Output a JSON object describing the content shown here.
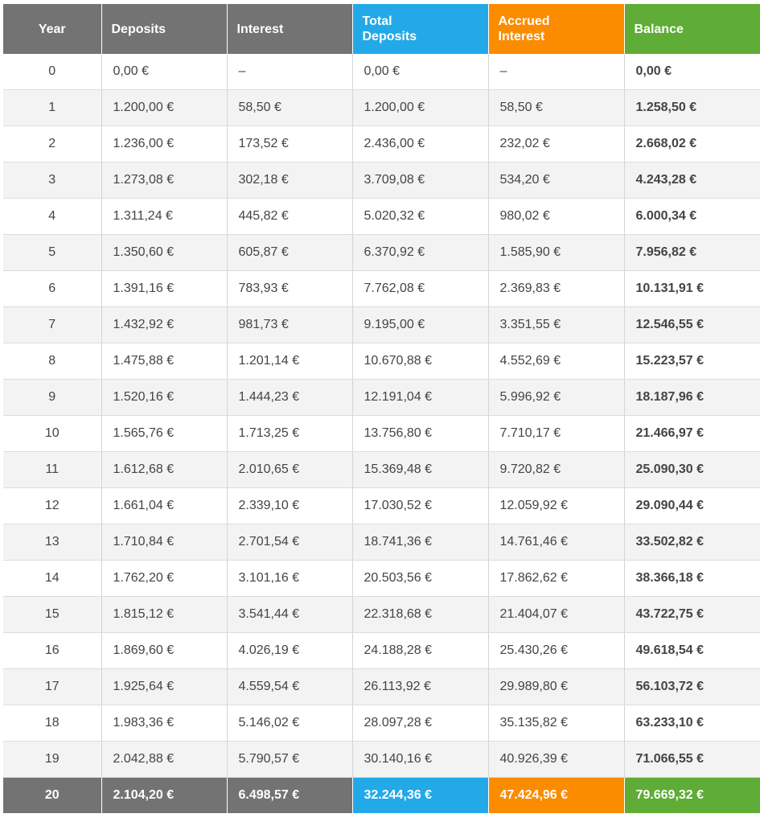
{
  "table": {
    "headers": {
      "year": "Year",
      "deposits": "Deposits",
      "interest": "Interest",
      "total_deposits_line1": "Total",
      "total_deposits_line2": "Deposits",
      "accrued_interest_line1": "Accrued",
      "accrued_interest_line2": "Interest",
      "balance": "Balance"
    },
    "rows": [
      {
        "year": "0",
        "deposits": "0,00 €",
        "interest": "–",
        "total_deposits": "0,00 €",
        "accrued_interest": "–",
        "balance": "0,00 €"
      },
      {
        "year": "1",
        "deposits": "1.200,00 €",
        "interest": "58,50 €",
        "total_deposits": "1.200,00 €",
        "accrued_interest": "58,50 €",
        "balance": "1.258,50 €"
      },
      {
        "year": "2",
        "deposits": "1.236,00 €",
        "interest": "173,52 €",
        "total_deposits": "2.436,00 €",
        "accrued_interest": "232,02 €",
        "balance": "2.668,02 €"
      },
      {
        "year": "3",
        "deposits": "1.273,08 €",
        "interest": "302,18 €",
        "total_deposits": "3.709,08 €",
        "accrued_interest": "534,20 €",
        "balance": "4.243,28 €"
      },
      {
        "year": "4",
        "deposits": "1.311,24 €",
        "interest": "445,82 €",
        "total_deposits": "5.020,32 €",
        "accrued_interest": "980,02 €",
        "balance": "6.000,34 €"
      },
      {
        "year": "5",
        "deposits": "1.350,60 €",
        "interest": "605,87 €",
        "total_deposits": "6.370,92 €",
        "accrued_interest": "1.585,90 €",
        "balance": "7.956,82 €"
      },
      {
        "year": "6",
        "deposits": "1.391,16 €",
        "interest": "783,93 €",
        "total_deposits": "7.762,08 €",
        "accrued_interest": "2.369,83 €",
        "balance": "10.131,91 €"
      },
      {
        "year": "7",
        "deposits": "1.432,92 €",
        "interest": "981,73 €",
        "total_deposits": "9.195,00 €",
        "accrued_interest": "3.351,55 €",
        "balance": "12.546,55 €"
      },
      {
        "year": "8",
        "deposits": "1.475,88 €",
        "interest": "1.201,14 €",
        "total_deposits": "10.670,88 €",
        "accrued_interest": "4.552,69 €",
        "balance": "15.223,57 €"
      },
      {
        "year": "9",
        "deposits": "1.520,16 €",
        "interest": "1.444,23 €",
        "total_deposits": "12.191,04 €",
        "accrued_interest": "5.996,92 €",
        "balance": "18.187,96 €"
      },
      {
        "year": "10",
        "deposits": "1.565,76 €",
        "interest": "1.713,25 €",
        "total_deposits": "13.756,80 €",
        "accrued_interest": "7.710,17 €",
        "balance": "21.466,97 €"
      },
      {
        "year": "11",
        "deposits": "1.612,68 €",
        "interest": "2.010,65 €",
        "total_deposits": "15.369,48 €",
        "accrued_interest": "9.720,82 €",
        "balance": "25.090,30 €"
      },
      {
        "year": "12",
        "deposits": "1.661,04 €",
        "interest": "2.339,10 €",
        "total_deposits": "17.030,52 €",
        "accrued_interest": "12.059,92 €",
        "balance": "29.090,44 €"
      },
      {
        "year": "13",
        "deposits": "1.710,84 €",
        "interest": "2.701,54 €",
        "total_deposits": "18.741,36 €",
        "accrued_interest": "14.761,46 €",
        "balance": "33.502,82 €"
      },
      {
        "year": "14",
        "deposits": "1.762,20 €",
        "interest": "3.101,16 €",
        "total_deposits": "20.503,56 €",
        "accrued_interest": "17.862,62 €",
        "balance": "38.366,18 €"
      },
      {
        "year": "15",
        "deposits": "1.815,12 €",
        "interest": "3.541,44 €",
        "total_deposits": "22.318,68 €",
        "accrued_interest": "21.404,07 €",
        "balance": "43.722,75 €"
      },
      {
        "year": "16",
        "deposits": "1.869,60 €",
        "interest": "4.026,19 €",
        "total_deposits": "24.188,28 €",
        "accrued_interest": "25.430,26 €",
        "balance": "49.618,54 €"
      },
      {
        "year": "17",
        "deposits": "1.925,64 €",
        "interest": "4.559,54 €",
        "total_deposits": "26.113,92 €",
        "accrued_interest": "29.989,80 €",
        "balance": "56.103,72 €"
      },
      {
        "year": "18",
        "deposits": "1.983,36 €",
        "interest": "5.146,02 €",
        "total_deposits": "28.097,28 €",
        "accrued_interest": "35.135,82 €",
        "balance": "63.233,10 €"
      },
      {
        "year": "19",
        "deposits": "2.042,88 €",
        "interest": "5.790,57 €",
        "total_deposits": "30.140,16 €",
        "accrued_interest": "40.926,39 €",
        "balance": "71.066,55 €"
      }
    ],
    "total_row": {
      "year": "20",
      "deposits": "2.104,20 €",
      "interest": "6.498,57 €",
      "total_deposits": "32.244,36 €",
      "accrued_interest": "47.424,96 €",
      "balance": "79.669,32 €"
    }
  },
  "colors": {
    "header_gray": "#737373",
    "total_deposits_blue": "#24a9e8",
    "accrued_interest_orange": "#fb8c00",
    "balance_green": "#5fac36"
  }
}
